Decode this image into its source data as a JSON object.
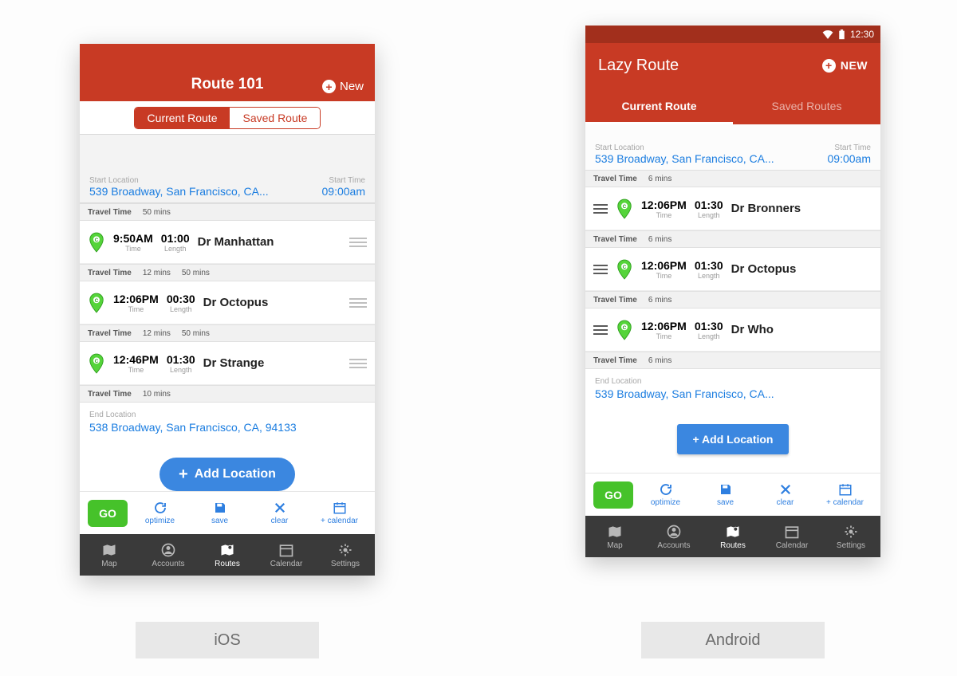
{
  "ios": {
    "title": "Route 101",
    "new_label": "New",
    "segments": {
      "current": "Current Route",
      "saved": "Saved Route"
    },
    "start": {
      "label": "Start Location",
      "addr": "539 Broadway, San Francisco, CA...",
      "time_label": "Start Time",
      "time": "09:00am"
    },
    "stops": [
      {
        "travel": "50 mins",
        "extra": "",
        "time": "9:50AM",
        "length": "01:00",
        "name": "Dr Manhattan"
      },
      {
        "travel": "12 mins",
        "extra": "50 mins",
        "time": "12:06PM",
        "length": "00:30",
        "name": "Dr Octopus"
      },
      {
        "travel": "12 mins",
        "extra": "50 mins",
        "time": "12:46PM",
        "length": "01:30",
        "name": "Dr Strange"
      }
    ],
    "end_travel": "10 mins",
    "end": {
      "label": "End Location",
      "addr": "538 Broadway, San Francisco, CA, 94133"
    },
    "add_label": "Add Location",
    "actions": {
      "go": "GO",
      "optimize": "optimize",
      "save": "save",
      "clear": "clear",
      "calendar": "+ calendar"
    },
    "tabs": {
      "map": "Map",
      "accounts": "Accounts",
      "routes": "Routes",
      "calendar": "Calendar",
      "settings": "Settings"
    }
  },
  "android": {
    "status_time": "12:30",
    "title": "Lazy Route",
    "new_label": "NEW",
    "segments": {
      "current": "Current Route",
      "saved": "Saved Routes"
    },
    "start": {
      "label": "Start Location",
      "addr": "539 Broadway, San Francisco, CA...",
      "time_label": "Start Time",
      "time": "09:00am"
    },
    "stops": [
      {
        "travel": "6 mins",
        "time": "12:06PM",
        "length": "01:30",
        "name": "Dr Bronners"
      },
      {
        "travel": "6 mins",
        "time": "12:06PM",
        "length": "01:30",
        "name": "Dr Octopus"
      },
      {
        "travel": "6 mins",
        "time": "12:06PM",
        "length": "01:30",
        "name": "Dr Who"
      }
    ],
    "end_travel": "6 mins",
    "end": {
      "label": "End Location",
      "addr": "539 Broadway, San Francisco, CA..."
    },
    "add_label": "+ Add Location",
    "actions": {
      "go": "GO",
      "optimize": "optimize",
      "save": "save",
      "clear": "clear",
      "calendar": "+ calendar"
    },
    "tabs": {
      "map": "Map",
      "accounts": "Accounts",
      "routes": "Routes",
      "calendar": "Calendar",
      "settings": "Settings"
    },
    "labels": {
      "time": "Time",
      "length": "Length",
      "travel": "Travel Time"
    }
  },
  "common": {
    "time_sub": "Time",
    "length_sub": "Length",
    "travel": "Travel Time"
  },
  "platform": {
    "ios": "iOS",
    "android": "Android"
  }
}
